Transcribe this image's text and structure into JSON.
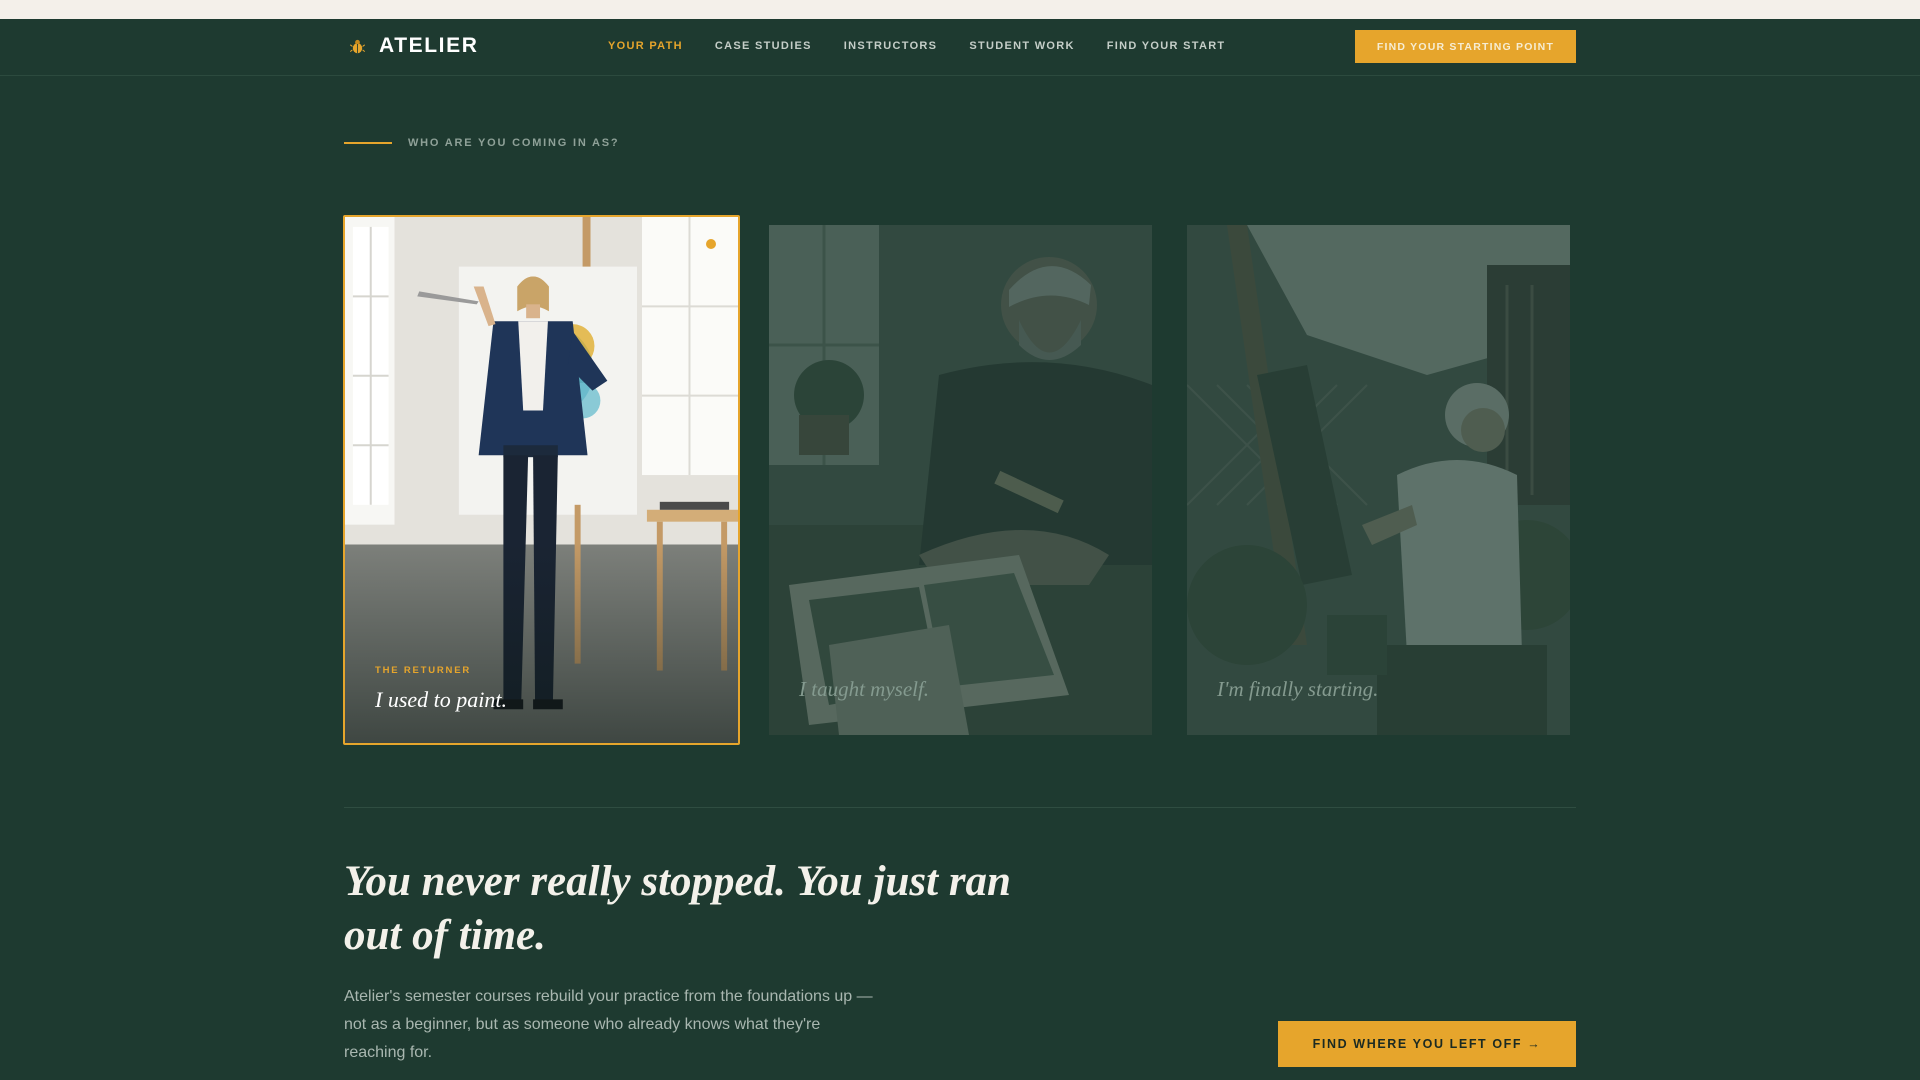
{
  "brand": {
    "name": "ATELIER",
    "icon": "beetle-icon"
  },
  "nav": {
    "links": [
      {
        "label": "YOUR PATH",
        "active": true
      },
      {
        "label": "CASE STUDIES",
        "active": false
      },
      {
        "label": "INSTRUCTORS",
        "active": false
      },
      {
        "label": "STUDENT WORK",
        "active": false
      },
      {
        "label": "FIND YOUR START",
        "active": false
      }
    ],
    "cta_label": "FIND YOUR STARTING POINT"
  },
  "section": {
    "eyebrow": "WHO ARE YOU COMING IN AS?"
  },
  "cards": [
    {
      "tag": "THE RETURNER",
      "quote": "I used to paint.",
      "selected": true
    },
    {
      "quote": "I taught myself.",
      "selected": false
    },
    {
      "quote": "I'm finally starting.",
      "selected": false
    }
  ],
  "hero": {
    "headline": "You never really stopped. You just ran out of time.",
    "body": "Atelier's semester courses rebuild your practice from the foundations up — not as a beginner, but as someone who already knows what they're reaching for.",
    "cta_label": "FIND WHERE YOU LEFT OFF →"
  },
  "colors": {
    "background": "#1e3a30",
    "accent": "#e6a52c",
    "top_strip": "#f4f0ea"
  }
}
